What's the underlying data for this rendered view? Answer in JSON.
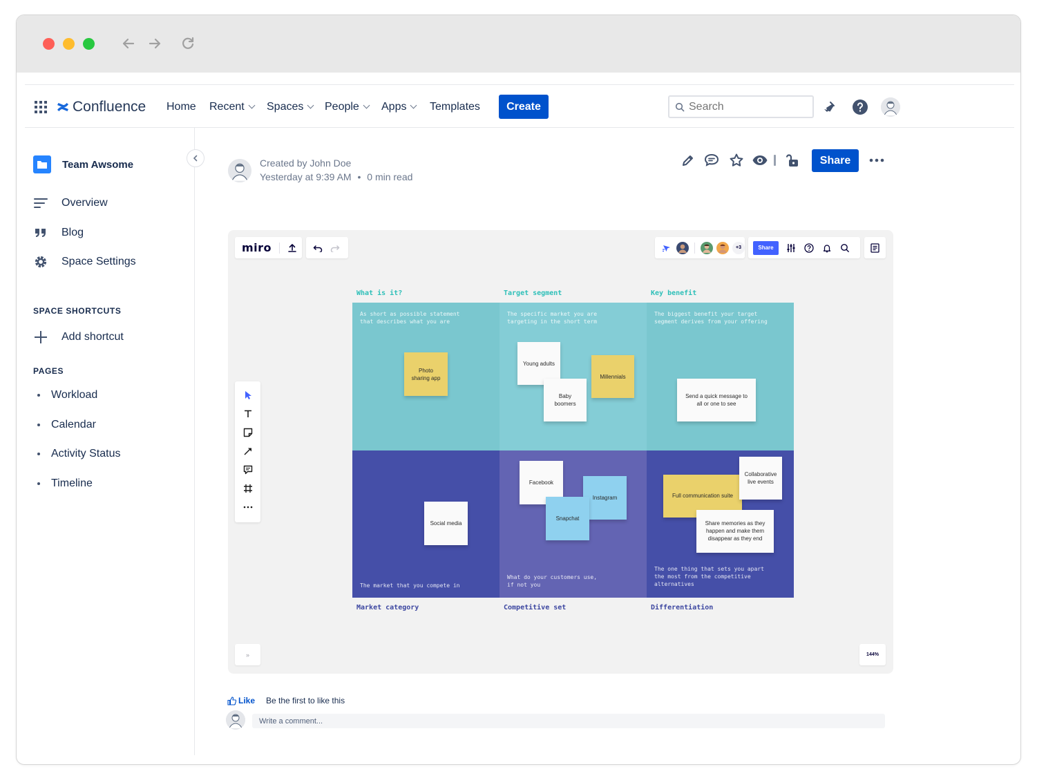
{
  "nav": {
    "brand": "Confluence",
    "items": [
      {
        "label": "Home"
      },
      {
        "label": "Recent"
      },
      {
        "label": "Spaces"
      },
      {
        "label": "People"
      },
      {
        "label": "Apps"
      },
      {
        "label": "Templates"
      }
    ],
    "create_label": "Create",
    "search_placeholder": "Search"
  },
  "sidebar": {
    "space_name": "Team Awsome",
    "items": [
      {
        "label": "Overview"
      },
      {
        "label": "Blog"
      },
      {
        "label": "Space Settings"
      }
    ],
    "shortcuts_heading": "SPACE SHORTCUTS",
    "add_shortcut": "Add shortcut",
    "pages_heading": "PAGES",
    "pages": [
      {
        "label": "Workload"
      },
      {
        "label": "Calendar"
      },
      {
        "label": "Activity Status"
      },
      {
        "label": "Timeline"
      }
    ]
  },
  "page": {
    "created_by": "Created by John Doe",
    "timestamp": "Yesterday at 9:39 AM",
    "separator": "•",
    "read_time": "0 min read",
    "share_label": "Share"
  },
  "miro": {
    "logo": "miro",
    "share_label": "Share",
    "collaborators_extra": "+3",
    "zoom": "144%",
    "expand": "»",
    "columns_top": [
      "What is it?",
      "Target segment",
      "Key benefit"
    ],
    "columns_bottom": [
      "Market category",
      "Competitive set",
      "Differentiation"
    ],
    "descs": {
      "what": "As short as possible statement\nthat describes what you are",
      "target": "The specific market you are\ntargeting in the short term",
      "benefit": "The biggest benefit your target\nsegment derives from your offering",
      "market": "The market that you compete in",
      "competitive": "What do your customers use,\nif not you",
      "diff": "The one thing that sets you apart\nthe most from the competitive\nalternatives"
    },
    "stickies": {
      "photo": "Photo\nsharing app",
      "young": "Young adults",
      "millennials": "Millennials",
      "boomers": "Baby\nboomers",
      "message": "Send a quick message to\nall or one to see",
      "social": "Social media",
      "facebook": "Facebook",
      "instagram": "Instagram",
      "snapchat": "Snapchat",
      "collab": "Collaborative\nlive events",
      "fullcomm": "Full communication suite",
      "memories": "Share memories as they\nhappen and make them\ndisappear as they end"
    },
    "colors": {
      "teal": "#7ac7cf",
      "teal_mid": "#84cdd6",
      "indigo": "#454fa8",
      "indigo_mid": "#6364b3"
    }
  },
  "footer": {
    "like": "Like",
    "like_text": "Be the first to like this",
    "comment_placeholder": "Write a comment..."
  }
}
